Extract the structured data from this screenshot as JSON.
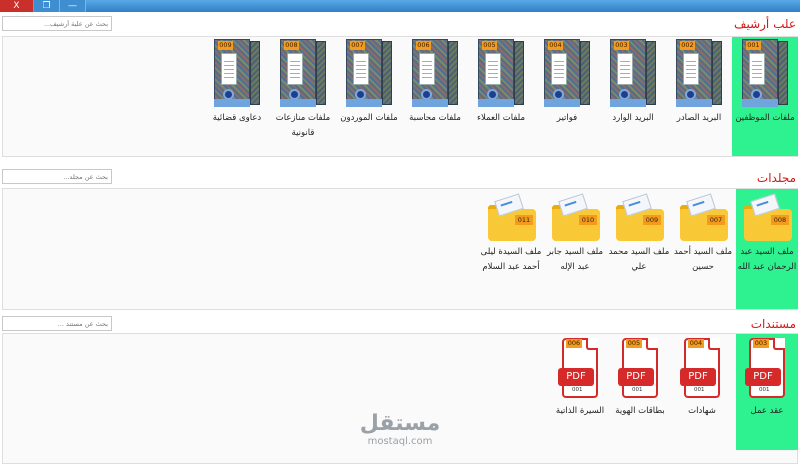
{
  "window": {
    "close_label": "X",
    "buttons": [
      "—",
      "❐",
      "□"
    ]
  },
  "archive": {
    "title": "علب أرشيف",
    "search_placeholder": "بحث عن علبة أرشيف...",
    "items": [
      {
        "code": "001",
        "label": "ملفات الموظفين",
        "selected": true
      },
      {
        "code": "002",
        "label": "البريد الصادر"
      },
      {
        "code": "003",
        "label": "البريد الوارد"
      },
      {
        "code": "004",
        "label": "فواتير"
      },
      {
        "code": "005",
        "label": "ملفات العملاء"
      },
      {
        "code": "006",
        "label": "ملفات محاسبة"
      },
      {
        "code": "007",
        "label": "ملفات الموردون"
      },
      {
        "code": "008",
        "label": "ملفات منازعات قانونية"
      },
      {
        "code": "009",
        "label": "دعاوى قضائية"
      }
    ]
  },
  "folders": {
    "title": "مجلدات",
    "search_placeholder": "بحث عن مجلد...",
    "items": [
      {
        "code": "008",
        "label": "ملف السيد عبد الرحمان عبد الله",
        "selected": true
      },
      {
        "code": "007",
        "label": "ملف السيد أحمد حسين"
      },
      {
        "code": "009",
        "label": "ملف السيد محمد علي"
      },
      {
        "code": "010",
        "label": "ملف السيد جابر عبد الإله"
      },
      {
        "code": "011",
        "label": "ملف السيدة ليلى أحمد عبد السلام"
      }
    ]
  },
  "documents": {
    "title": "مستندات",
    "search_placeholder": "بحث عن مستند ...",
    "items": [
      {
        "code": "003",
        "sub": "001",
        "badge": "PDF",
        "label": "عقد عمل",
        "selected": true
      },
      {
        "code": "004",
        "sub": "001",
        "badge": "PDF",
        "label": "شهادات"
      },
      {
        "code": "005",
        "sub": "001",
        "badge": "PDF",
        "label": "بطاقات الهوية"
      },
      {
        "code": "006",
        "sub": "001",
        "badge": "PDF",
        "label": "السيرة الذاتية"
      }
    ]
  },
  "watermark": {
    "text": "مستقل",
    "domain": "mostaql.com"
  },
  "colors": {
    "section_title": "#d11919",
    "selected": "#2ef28f",
    "code_badge": "#f29b1e",
    "pdf_red": "#d62a2a"
  }
}
